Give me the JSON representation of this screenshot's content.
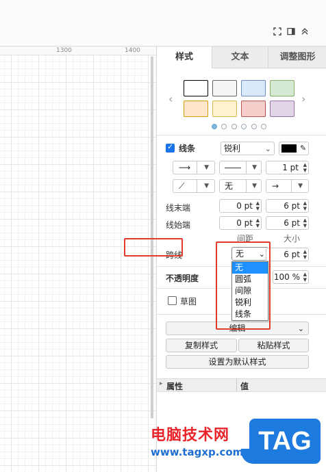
{
  "ruler": {
    "ticks": [
      "1300",
      "1400"
    ]
  },
  "toolbar": {
    "icons": [
      "fullscreen-icon",
      "panel-toggle-icon",
      "collapse-icon"
    ]
  },
  "tabs": [
    {
      "label": "样式",
      "active": true
    },
    {
      "label": "文本",
      "active": false
    },
    {
      "label": "调整图形",
      "active": false
    }
  ],
  "swatches": [
    {
      "fill": "#ffffff",
      "border": "#000000"
    },
    {
      "fill": "#f5f5f5",
      "border": "#666666"
    },
    {
      "fill": "#dae8fc",
      "border": "#6c8ebf"
    },
    {
      "fill": "#d5e8d4",
      "border": "#82b366"
    },
    {
      "fill": "#ffe6cc",
      "border": "#d79b00"
    },
    {
      "fill": "#fff2cc",
      "border": "#d6b656"
    },
    {
      "fill": "#f8cecc",
      "border": "#b85450"
    },
    {
      "fill": "#e1d5e7",
      "border": "#9673a6"
    }
  ],
  "line": {
    "label": "线条",
    "checked": true,
    "style_value": "锐利",
    "color": "#000000",
    "width_value": "1 pt",
    "waypoint_value": "无"
  },
  "line_end": {
    "label": "线末端",
    "spacing": "0 pt",
    "size": "6 pt"
  },
  "line_start": {
    "label": "线始端",
    "spacing": "0 pt",
    "size": "6 pt"
  },
  "col_headers": {
    "spacing": "间距",
    "size": "大小"
  },
  "jump": {
    "label": "跨线",
    "selected": "无",
    "size": "6 pt",
    "options": [
      "无",
      "圆弧",
      "间隙",
      "锐利",
      "线条"
    ]
  },
  "opacity": {
    "label": "不透明度",
    "value": "100 %"
  },
  "sketch": {
    "label": "草图",
    "checked": false
  },
  "edit": {
    "label": "编辑"
  },
  "copy_style": "复制样式",
  "paste_style": "粘贴样式",
  "set_default": "设置为默认样式",
  "properties": {
    "col_property": "属性",
    "col_value": "值"
  },
  "watermark": {
    "title": "电脑技术网",
    "url": "www.tagxp.com",
    "logo": "TAG"
  },
  "colors": {
    "accent": "#1a73e8",
    "highlight": "#e23b2e",
    "selection": "#1e90ff"
  }
}
